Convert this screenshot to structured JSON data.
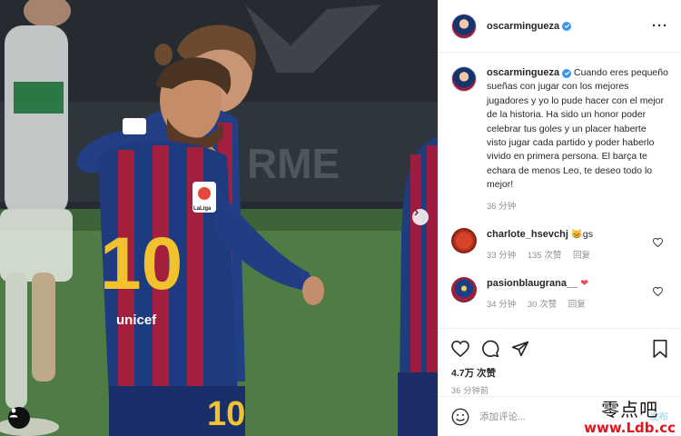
{
  "post": {
    "username": "oscarmingueza",
    "caption": "Cuando eres pequeño sueñas con jugar con los mejores jugadores y yo lo pude hacer con el mejor de la historia. Ha sido un honor poder celebrar tus goles y un placer haberte visto jugar cada partido y poder haberlo vivido en primera persona. El barça te echara de menos Leo, te deseo todo lo mejor!",
    "caption_time": "36 分钟",
    "likes": "4.7万 次赞",
    "time_ago": "36 分钟前"
  },
  "comments": [
    {
      "username": "charlote_hsevchj",
      "text": "gs",
      "emoji": "😸",
      "time": "33 分钟",
      "likes": "135 次赞",
      "reply": "回复"
    },
    {
      "username": "pasionblaugrana__",
      "text": "",
      "emoji": "❤",
      "time": "34 分钟",
      "likes": "30 次赞",
      "reply": "回复"
    }
  ],
  "add_comment": {
    "placeholder": "添加评论...",
    "post_label": "发布"
  },
  "photo": {
    "jersey_number": "10",
    "sponsor": "unicef",
    "wall_text": "RME",
    "sleeve_badge": "LaLiga"
  },
  "icons": {
    "verified": "verified-badge-icon",
    "more": "more-options-icon",
    "like": "heart-icon",
    "comment": "comment-icon",
    "share": "share-icon",
    "save": "bookmark-icon",
    "emoji": "emoji-icon",
    "user_tag": "user-tag-icon",
    "next": "chevron-right-icon"
  },
  "colors": {
    "link_blue": "#3897f0",
    "post_disabled": "#b2dffc",
    "heart_red": "#ed4956",
    "watermark_red": "#e3141b"
  },
  "watermark": {
    "cn": "零点吧",
    "url": "www.Ldb.cc"
  }
}
